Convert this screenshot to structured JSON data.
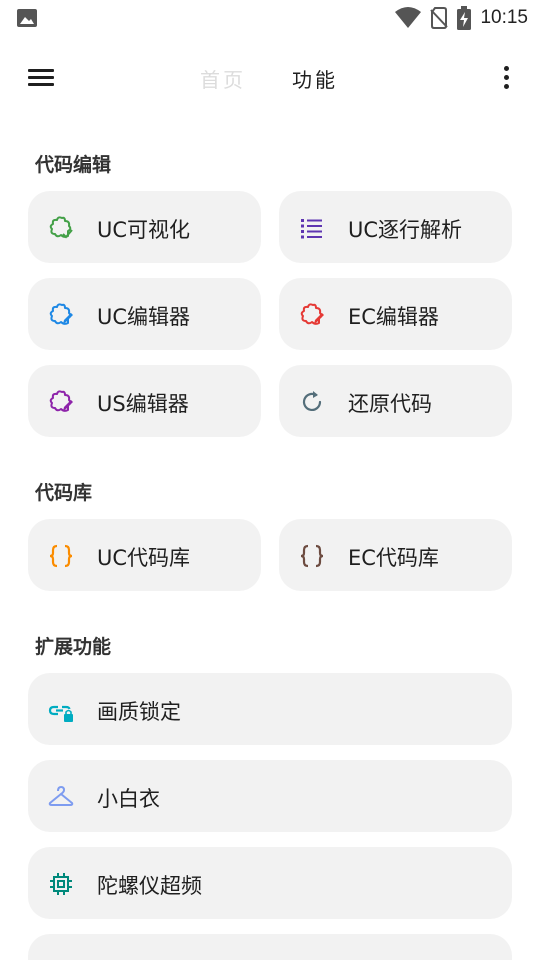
{
  "status_bar": {
    "time": "10:15",
    "icons": [
      "image-icon",
      "wifi-icon",
      "no-sim-icon",
      "battery-charging-icon"
    ]
  },
  "top_bar": {
    "tab_home": "首页",
    "tab_function": "功能",
    "icons": [
      "menu-icon",
      "more-vert-icon"
    ]
  },
  "sections": {
    "code_edit": {
      "title": "代码编辑",
      "items": [
        {
          "label": "UC可视化",
          "icon": "puzzle-check-icon",
          "color": "#43a047"
        },
        {
          "label": "UC逐行解析",
          "icon": "list-icon",
          "color": "#5e35b1"
        },
        {
          "label": "UC编辑器",
          "icon": "puzzle-edit-icon",
          "color": "#1e88e5"
        },
        {
          "label": "EC编辑器",
          "icon": "puzzle-edit-icon",
          "color": "#e53935"
        },
        {
          "label": "US编辑器",
          "icon": "puzzle-edit-icon",
          "color": "#8e24aa"
        },
        {
          "label": "还原代码",
          "icon": "restore-icon",
          "color": "#546e7a"
        }
      ]
    },
    "code_lib": {
      "title": "代码库",
      "items": [
        {
          "label": "UC代码库",
          "icon": "braces-icon",
          "color": "#fb8c00"
        },
        {
          "label": "EC代码库",
          "icon": "braces-icon",
          "color": "#6d4c41"
        }
      ]
    },
    "extensions": {
      "title": "扩展功能",
      "items": [
        {
          "label": "画质锁定",
          "icon": "link-lock-icon",
          "color": "#00acc1"
        },
        {
          "label": "小白衣",
          "icon": "hanger-icon",
          "color": "#7e9cf0"
        },
        {
          "label": "陀螺仪超频",
          "icon": "chip-icon",
          "color": "#00897b"
        },
        {
          "label": "",
          "icon": "partial-icon",
          "color": "#e53935"
        }
      ]
    }
  }
}
